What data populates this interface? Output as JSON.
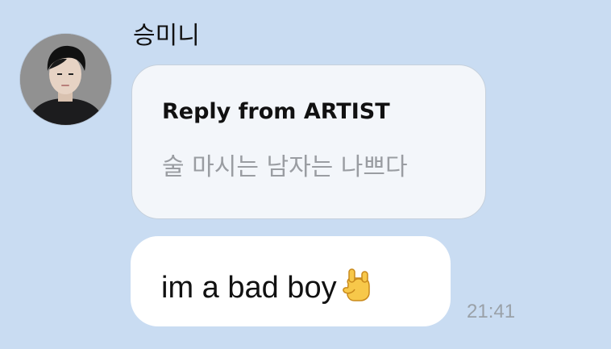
{
  "message": {
    "sender_name": "승미니",
    "avatar_icon": "profile-photo",
    "reply": {
      "header": "Reply from ARTIST",
      "quoted_text": "술 마시는 남자는 나쁘다"
    },
    "text": "im a bad boy",
    "emoji_icon": "sign-of-the-horns-emoji",
    "time": "21:41"
  },
  "colors": {
    "background": "#c9dcf2",
    "reply_bubble": "#f3f6fa",
    "message_bubble": "#ffffff",
    "quote_text": "#9a9da2",
    "timestamp_text": "#9aa1a8"
  }
}
